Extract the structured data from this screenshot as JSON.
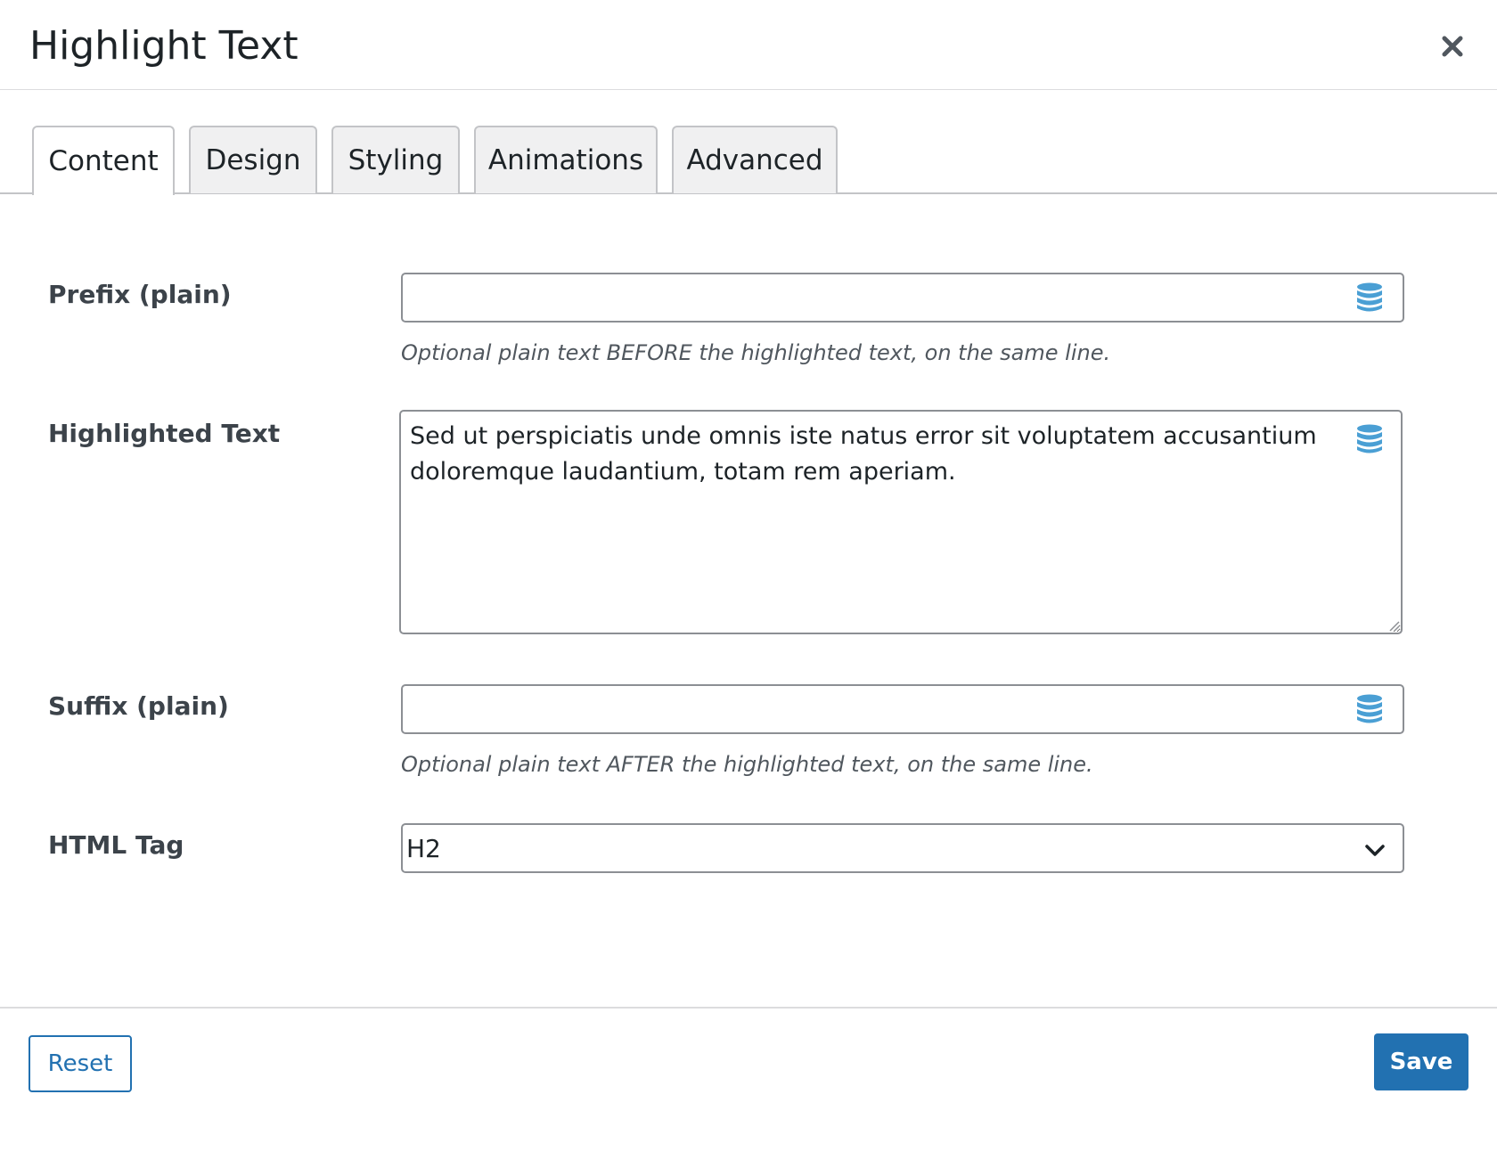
{
  "dialog": {
    "title": "Highlight Text",
    "close_icon": "close-icon"
  },
  "tabs": [
    {
      "label": "Content",
      "active": true
    },
    {
      "label": "Design",
      "active": false
    },
    {
      "label": "Styling",
      "active": false
    },
    {
      "label": "Animations",
      "active": false
    },
    {
      "label": "Advanced",
      "active": false
    }
  ],
  "fields": {
    "prefix": {
      "label": "Prefix (plain)",
      "value": "",
      "help": "Optional plain text BEFORE the highlighted text, on the same line.",
      "icon": "database-icon"
    },
    "highlighted": {
      "label": "Highlighted Text",
      "value": "Sed ut perspiciatis unde omnis iste natus error sit voluptatem accusantium doloremque laudantium, totam rem aperiam.",
      "icon": "database-icon"
    },
    "suffix": {
      "label": "Suffix (plain)",
      "value": "",
      "help": "Optional plain text AFTER the highlighted text, on the same line.",
      "icon": "database-icon"
    },
    "html_tag": {
      "label": "HTML Tag",
      "selected": "H2",
      "icon": "chevron-down-icon"
    }
  },
  "footer": {
    "reset_label": "Reset",
    "save_label": "Save"
  },
  "colors": {
    "accent": "#2271b1",
    "db_icon": "#4a9fd4"
  }
}
